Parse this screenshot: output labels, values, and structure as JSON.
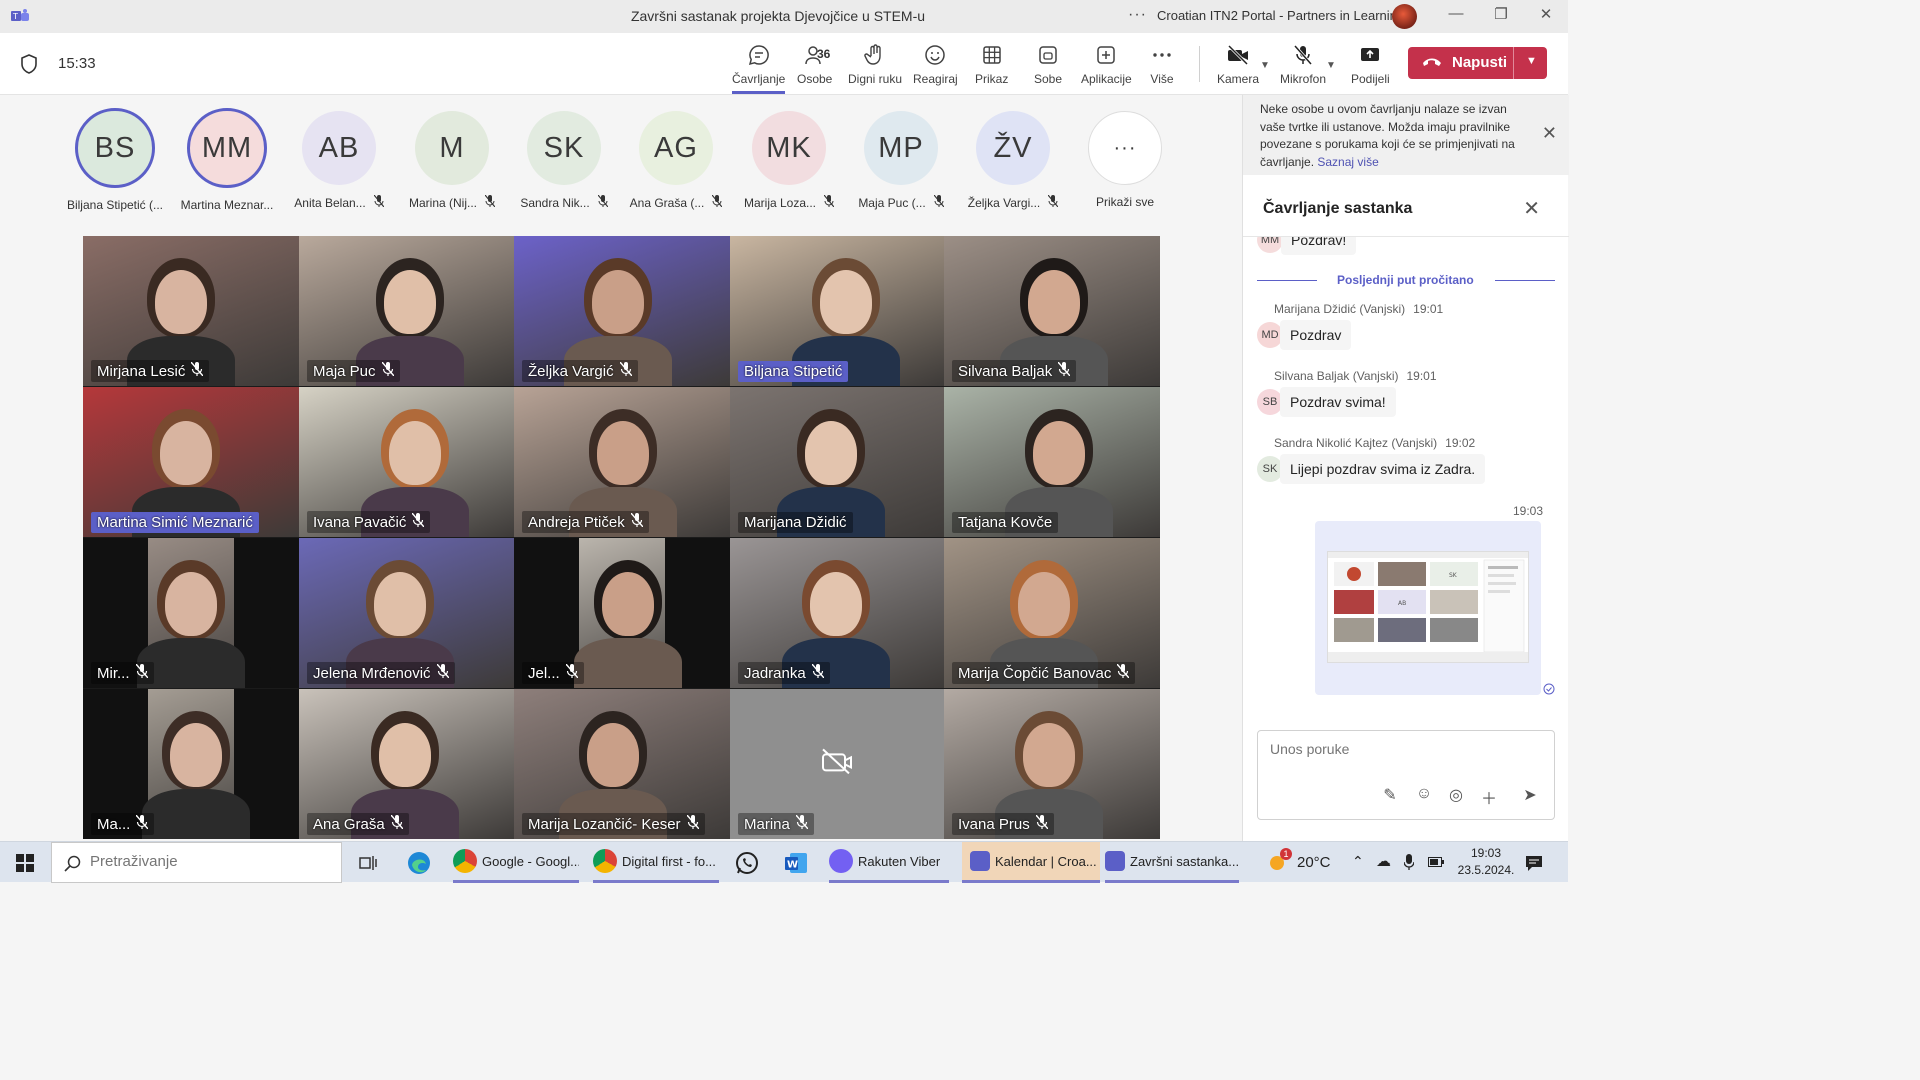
{
  "window": {
    "title": "Završni sastanak projekta Djevojčice u STEM-u",
    "org": "Croatian ITN2 Portal - Partners in Learning",
    "more": "···"
  },
  "toolbar": {
    "time": "15:33",
    "buttons": {
      "chat": "Čavrljanje",
      "people": "Osobe",
      "people_count": "36",
      "raise": "Digni ruku",
      "react": "Reagiraj",
      "view": "Prikaz",
      "rooms": "Sobe",
      "apps": "Aplikacije",
      "more": "Više",
      "camera": "Kamera",
      "mic": "Mikrofon",
      "share": "Podijeli"
    },
    "leave": "Napusti"
  },
  "participants_strip": [
    {
      "initials": "BS",
      "name": "Biljana Stipetić (...",
      "bg": "#dbe9dd",
      "muted": false
    },
    {
      "initials": "MM",
      "name": "Martina Meznar...",
      "bg": "#f5dcdc",
      "muted": false
    },
    {
      "initials": "AB",
      "name": "Anita Belan...",
      "bg": "#e6e3f2",
      "muted": true
    },
    {
      "initials": "M",
      "name": "Marina (Nij...",
      "bg": "#e2eadd",
      "muted": true
    },
    {
      "initials": "SK",
      "name": "Sandra Nik...",
      "bg": "#e2ebe0",
      "muted": true
    },
    {
      "initials": "AG",
      "name": "Ana Graša (...",
      "bg": "#e8f0df",
      "muted": true
    },
    {
      "initials": "MK",
      "name": "Marija Loza...",
      "bg": "#f2dde0",
      "muted": true
    },
    {
      "initials": "MP",
      "name": "Maja Puc (...",
      "bg": "#dfe9ef",
      "muted": true
    },
    {
      "initials": "ŽV",
      "name": "Željka Vargi...",
      "bg": "#dfe3f5",
      "muted": true
    },
    {
      "initials": "···",
      "name": "Prikaži sve",
      "bg": "#ffffff",
      "muted": false
    }
  ],
  "video_tiles": [
    {
      "name": "Mirjana Lesić",
      "muted": true,
      "bg": "#8a6d66",
      "hl": false
    },
    {
      "name": "Maja Puc",
      "muted": true,
      "bg": "#b9a99c",
      "hl": false
    },
    {
      "name": "Željka Vargić",
      "muted": true,
      "bg": "#6c62c9",
      "hl": false
    },
    {
      "name": "Biljana Stipetić",
      "muted": false,
      "bg": "#c9b6a1",
      "hl": true
    },
    {
      "name": "Silvana Baljak",
      "muted": true,
      "bg": "#9c8f86",
      "hl": false
    },
    {
      "name": "Martina Simić Meznarić",
      "muted": false,
      "bg": "#b5383a",
      "hl": true
    },
    {
      "name": "Ivana Pavačić",
      "muted": true,
      "bg": "#d6d2c5",
      "hl": false
    },
    {
      "name": "Andreja Ptiček",
      "muted": true,
      "bg": "#b8a396",
      "hl": false
    },
    {
      "name": "Marijana Džidić",
      "muted": false,
      "bg": "#7c7470",
      "hl": false
    },
    {
      "name": "Tatjana Kovče",
      "muted": false,
      "bg": "#aab3a7",
      "hl": false
    },
    {
      "name": "Mir...",
      "muted": true,
      "bg": "#a2958d",
      "hl": false
    },
    {
      "name": "Jelena Mrđenović",
      "muted": true,
      "bg": "#6b69b7",
      "hl": false
    },
    {
      "name": "Jel...",
      "muted": true,
      "bg": "#c9c3ba",
      "hl": false
    },
    {
      "name": "Jadranka",
      "muted": true,
      "bg": "#9a9595",
      "hl": false
    },
    {
      "name": "Marija Čopčić Banovac",
      "muted": true,
      "bg": "#a19385",
      "hl": false
    },
    {
      "name": "Ma...",
      "muted": true,
      "bg": "#b0a89e",
      "hl": false
    },
    {
      "name": "Ana Graša",
      "muted": true,
      "bg": "#c9c2ba",
      "hl": false
    },
    {
      "name": "Marija Lozančić- Keser",
      "muted": true,
      "bg": "#8e7f7b",
      "hl": false
    },
    {
      "name": "Marina",
      "muted": true,
      "bg": "#8f8f8f",
      "hl": false,
      "camoff": true
    },
    {
      "name": "Ivana Prus",
      "muted": true,
      "bg": "#b3aaa3",
      "hl": false
    }
  ],
  "chat": {
    "notice": "Neke osobe u ovom čavrljanju nalaze se izvan vaše tvrtke ili ustanove. Možda imaju pravilnike povezane s porukama koji će se primjenjivati na čavrljanje.",
    "notice_link": "Saznaj više",
    "title": "Čavrljanje sastanka",
    "partial_msg": {
      "initials": "MM",
      "text": "Pozdrav!"
    },
    "last_read": "Posljednji put pročitano",
    "messages": [
      {
        "initials": "MD",
        "author": "Marijana Džidić (Vanjski)",
        "time": "19:01",
        "text": "Pozdrav",
        "color": "#f6d7d7"
      },
      {
        "initials": "SB",
        "author": "Silvana Baljak (Vanjski)",
        "time": "19:01",
        "text": "Pozdrav svima!",
        "color": "#f6d7dc"
      },
      {
        "initials": "SK",
        "author": "Sandra Nikolić Kajtez (Vanjski)",
        "time": "19:02",
        "text": "Lijepi pozdrav svima iz Zadra.",
        "color": "#e3ebe0"
      }
    ],
    "own_time": "19:03",
    "composer_placeholder": "Unos poruke"
  },
  "taskbar": {
    "search_placeholder": "Pretraživanje",
    "apps": [
      {
        "label": "Google - Googl...",
        "icon": "chrome-icon"
      },
      {
        "label": "Digital first - fo...",
        "icon": "chrome-icon"
      },
      {
        "label": "Rakuten Viber",
        "icon": "viber-icon"
      },
      {
        "label": "Kalendar | Croa...",
        "icon": "teams-icon"
      },
      {
        "label": "Završni sastanka...",
        "icon": "teams-icon"
      }
    ],
    "weather": "20°C",
    "weather_badge": "1",
    "clock_time": "19:03",
    "clock_date": "23.5.2024."
  }
}
